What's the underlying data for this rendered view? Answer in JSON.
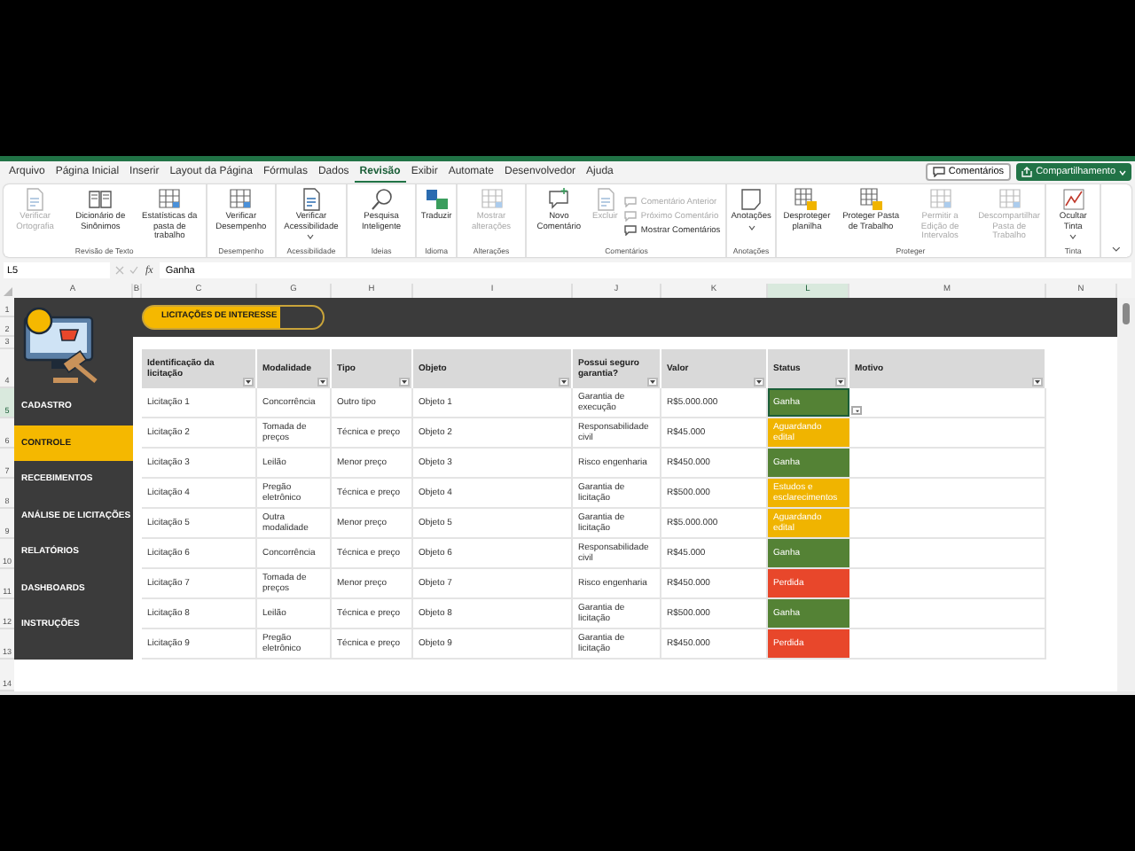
{
  "menu_tabs": [
    {
      "label": "Arquivo",
      "selected": false
    },
    {
      "label": "Página Inicial",
      "selected": false
    },
    {
      "label": "Inserir",
      "selected": false
    },
    {
      "label": "Layout da Página",
      "selected": false
    },
    {
      "label": "Fórmulas",
      "selected": false
    },
    {
      "label": "Dados",
      "selected": false
    },
    {
      "label": "Revisão",
      "selected": true
    },
    {
      "label": "Exibir",
      "selected": false
    },
    {
      "label": "Automate",
      "selected": false
    },
    {
      "label": "Desenvolvedor",
      "selected": false
    },
    {
      "label": "Ajuda",
      "selected": false
    }
  ],
  "comments_button": "Comentários",
  "share_button": "Compartilhamento",
  "ribbon": {
    "groups": [
      {
        "label": "Revisão de Texto",
        "buttons": [
          {
            "kind": "large",
            "label": "Verificar Ortografia",
            "disabled": true,
            "dropdown": false
          },
          {
            "kind": "large",
            "label": "Dicionário de Sinônimos",
            "disabled": false,
            "dropdown": false
          },
          {
            "kind": "large",
            "label": "Estatísticas da pasta de trabalho",
            "disabled": false,
            "dropdown": false
          }
        ]
      },
      {
        "label": "Desempenho",
        "buttons": [
          {
            "kind": "large",
            "label": "Verificar Desempenho",
            "disabled": false,
            "dropdown": false
          }
        ]
      },
      {
        "label": "Acessibilidade",
        "buttons": [
          {
            "kind": "large",
            "label": "Verificar Acessibilidade",
            "disabled": false,
            "dropdown": true
          }
        ]
      },
      {
        "label": "Ideias",
        "buttons": [
          {
            "kind": "large",
            "label": "Pesquisa Inteligente",
            "disabled": false,
            "dropdown": false
          }
        ]
      },
      {
        "label": "Idioma",
        "buttons": [
          {
            "kind": "large",
            "label": "Traduzir",
            "disabled": false,
            "dropdown": false
          }
        ]
      },
      {
        "label": "Alterações",
        "buttons": [
          {
            "kind": "large",
            "label": "Mostrar alterações",
            "disabled": true,
            "dropdown": false
          }
        ]
      },
      {
        "label": "Comentários",
        "buttons": [
          {
            "kind": "large",
            "label": "Novo Comentário",
            "disabled": false,
            "dropdown": false
          },
          {
            "kind": "large",
            "label": "Excluir",
            "disabled": true,
            "dropdown": false
          },
          {
            "kind": "small",
            "label": "Comentário Anterior",
            "disabled": true
          },
          {
            "kind": "small",
            "label": "Próximo Comentário",
            "disabled": true
          },
          {
            "kind": "small",
            "label": "Mostrar Comentários",
            "disabled": false
          }
        ]
      },
      {
        "label": "Anotações",
        "buttons": [
          {
            "kind": "large",
            "label": "Anotações",
            "disabled": false,
            "dropdown": true
          }
        ]
      },
      {
        "label": "Proteger",
        "buttons": [
          {
            "kind": "large",
            "label": "Desproteger planilha",
            "disabled": false,
            "dropdown": false
          },
          {
            "kind": "large",
            "label": "Proteger Pasta de Trabalho",
            "disabled": false,
            "dropdown": false
          },
          {
            "kind": "large",
            "label": "Permitir a Edição de Intervalos",
            "disabled": true,
            "dropdown": false
          },
          {
            "kind": "large",
            "label": "Descompartilhar Pasta de Trabalho",
            "disabled": true,
            "dropdown": false
          }
        ]
      },
      {
        "label": "Tinta",
        "buttons": [
          {
            "kind": "large",
            "label": "Ocultar Tinta",
            "disabled": false,
            "dropdown": true
          }
        ]
      }
    ]
  },
  "formula_bar": {
    "name_box": "L5",
    "function_label": "fx",
    "value": "Ganha"
  },
  "column_headers": [
    {
      "label": "A",
      "selected": false
    },
    {
      "label": "B",
      "selected": false
    },
    {
      "label": "C",
      "selected": false
    },
    {
      "label": "G",
      "selected": false
    },
    {
      "label": "H",
      "selected": false
    },
    {
      "label": "I",
      "selected": false
    },
    {
      "label": "J",
      "selected": false
    },
    {
      "label": "K",
      "selected": false
    },
    {
      "label": "L",
      "selected": true
    },
    {
      "label": "M",
      "selected": false
    },
    {
      "label": "N",
      "selected": false
    }
  ],
  "row_headers": [
    {
      "label": "1",
      "selected": false
    },
    {
      "label": "2",
      "selected": false
    },
    {
      "label": "3",
      "selected": false
    },
    {
      "label": "4",
      "selected": false
    },
    {
      "label": "5",
      "selected": true
    },
    {
      "label": "6",
      "selected": false
    },
    {
      "label": "7",
      "selected": false
    },
    {
      "label": "8",
      "selected": false
    },
    {
      "label": "9",
      "selected": false
    },
    {
      "label": "10",
      "selected": false
    },
    {
      "label": "11",
      "selected": false
    },
    {
      "label": "12",
      "selected": false
    },
    {
      "label": "13",
      "selected": false
    },
    {
      "label": "14",
      "selected": false
    }
  ],
  "sidebar": {
    "items": [
      {
        "label": "CADASTRO",
        "selected": false
      },
      {
        "label": "CONTROLE",
        "selected": true
      },
      {
        "label": "RECEBIMENTOS",
        "selected": false
      },
      {
        "label": "ANÁLISE DE LICITAÇÕES",
        "selected": false
      },
      {
        "label": "RELATÓRIOS",
        "selected": false
      },
      {
        "label": "DASHBOARDS",
        "selected": false
      },
      {
        "label": "INSTRUÇÕES",
        "selected": false
      }
    ]
  },
  "banner": "LICITAÇÕES DE INTERESSE",
  "table": {
    "columns": [
      "Identificação da licitação",
      "Modalidade",
      "Tipo",
      "Objeto",
      "Possui seguro garantia?",
      "Valor",
      "Status",
      "Motivo"
    ],
    "rows": [
      {
        "id": "Licitação 1",
        "modalidade": "Concorrência",
        "tipo": "Outro tipo",
        "objeto": "Objeto 1",
        "seguro": "Garantia de execução",
        "valor": "R$5.000.000",
        "status": "Ganha",
        "color": "#548235",
        "selected": true
      },
      {
        "id": "Licitação 2",
        "modalidade": "Tomada de preços",
        "tipo": "Técnica e preço",
        "objeto": "Objeto 2",
        "seguro": "Responsabilidade civil",
        "valor": "R$45.000",
        "status": "Aguardando edital",
        "color": "#f0b400",
        "selected": false
      },
      {
        "id": "Licitação 3",
        "modalidade": "Leilão",
        "tipo": "Menor preço",
        "objeto": "Objeto 3",
        "seguro": "Risco engenharia",
        "valor": "R$450.000",
        "status": "Ganha",
        "color": "#548235",
        "selected": false
      },
      {
        "id": "Licitação 4",
        "modalidade": "Pregão eletrônico",
        "tipo": "Técnica e preço",
        "objeto": "Objeto 4",
        "seguro": "Garantia de licitação",
        "valor": "R$500.000",
        "status": "Estudos e esclarecimentos",
        "color": "#f0b400",
        "selected": false
      },
      {
        "id": "Licitação 5",
        "modalidade": "Outra modalidade",
        "tipo": "Menor preço",
        "objeto": "Objeto 5",
        "seguro": "Garantia de licitação",
        "valor": "R$5.000.000",
        "status": "Aguardando edital",
        "color": "#f0b400",
        "selected": false
      },
      {
        "id": "Licitação 6",
        "modalidade": "Concorrência",
        "tipo": "Técnica e preço",
        "objeto": "Objeto 6",
        "seguro": "Responsabilidade civil",
        "valor": "R$45.000",
        "status": "Ganha",
        "color": "#548235",
        "selected": false
      },
      {
        "id": "Licitação 7",
        "modalidade": "Tomada de preços",
        "tipo": "Menor preço",
        "objeto": "Objeto 7",
        "seguro": "Risco engenharia",
        "valor": "R$450.000",
        "status": "Perdida",
        "color": "#e8472b",
        "selected": false
      },
      {
        "id": "Licitação 8",
        "modalidade": "Leilão",
        "tipo": "Técnica e preço",
        "objeto": "Objeto 8",
        "seguro": "Garantia de licitação",
        "valor": "R$500.000",
        "status": "Ganha",
        "color": "#548235",
        "selected": false
      },
      {
        "id": "Licitação 9",
        "modalidade": "Pregão eletrônico",
        "tipo": "Técnica e preço",
        "objeto": "Objeto 9",
        "seguro": "Garantia de licitação",
        "valor": "R$450.000",
        "status": "Perdida",
        "color": "#e8472b",
        "selected": false
      }
    ]
  }
}
